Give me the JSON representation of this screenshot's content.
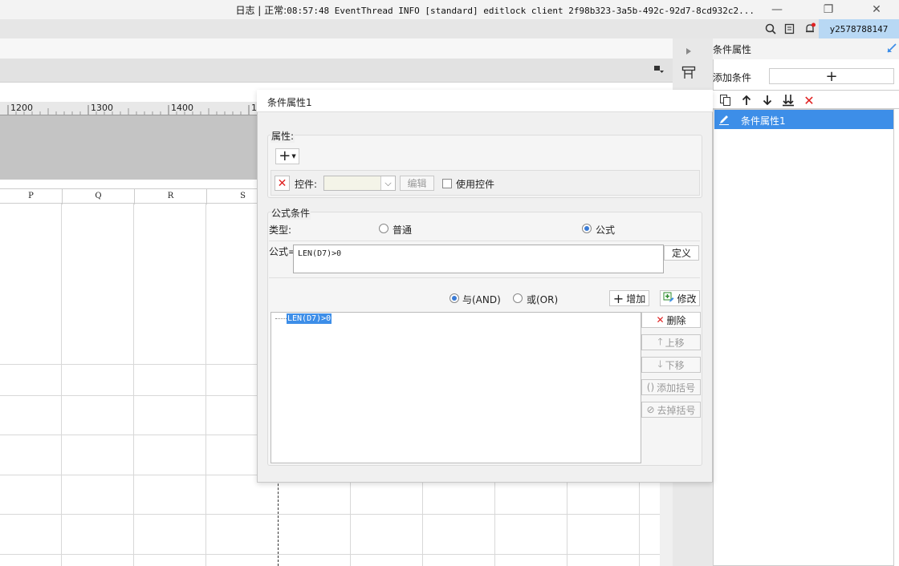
{
  "window": {
    "minimize": "—",
    "restore": "❐",
    "close": "✕"
  },
  "logbar": {
    "label": "日志",
    "separator": "|",
    "status": "正常:",
    "message": "08:57:48 EventThread INFO [standard] editlock client 2f98b323-3a5b-492c-92d7-8cd932c2...",
    "username": "y2578788147"
  },
  "ruler": {
    "ticks": [
      "1200",
      "1300",
      "1400",
      "1"
    ]
  },
  "columns": [
    "P",
    "Q",
    "R",
    "S"
  ],
  "right_panel": {
    "title": "条件属性",
    "add_condition_label": "添加条件",
    "add_button": "+",
    "items": [
      {
        "label": "条件属性1",
        "selected": true
      }
    ]
  },
  "dialog": {
    "title": "条件属性1",
    "attributes_group": "属性:",
    "add_attr": "+",
    "control_label": "控件:",
    "control_value": "",
    "edit_button": "编辑",
    "use_control": "使用控件",
    "formula_group": "公式条件",
    "type_label": "类型:",
    "type_normal": "普通",
    "type_formula": "公式",
    "formula_label": "公式=",
    "formula_value": "LEN(D7)>0",
    "define_button": "定义",
    "and_label": "与(AND)",
    "or_label": "或(OR)",
    "add_button": "增加",
    "modify_button": "修改",
    "delete_button": "删除",
    "move_up": "上移",
    "move_down": "下移",
    "add_bracket": "添加括号",
    "remove_bracket": "去掉括号",
    "conditions": [
      "LEN(D7)>0"
    ],
    "selected_type": "formula",
    "selected_logic": "and"
  },
  "colors": {
    "accent": "#3d8ee8",
    "user_bg": "#b8d8f4",
    "delete": "#e02020"
  }
}
